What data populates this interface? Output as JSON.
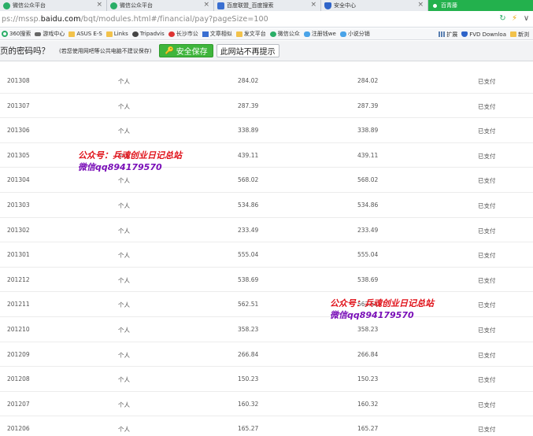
{
  "tabs": [
    {
      "label": "微信公众平台",
      "icon": "wechat-icon",
      "active": false
    },
    {
      "label": "微信公众平台",
      "icon": "wechat-icon",
      "active": false
    },
    {
      "label": "百度联盟_百度搜索",
      "icon": "baidu-paw-icon",
      "active": false
    },
    {
      "label": "安全中心",
      "icon": "shield-icon",
      "active": false
    },
    {
      "label": "百青藤",
      "icon": "baiqingteng-icon",
      "active": true
    }
  ],
  "tab_close": "×",
  "address": {
    "prefix": "ps://mssp.",
    "domain": "baidu.com",
    "path": "/bqt/modules.html#/financial/pay?pageSize=100"
  },
  "bookmarks": [
    {
      "label": "360搜索",
      "icon": "360-icon"
    },
    {
      "label": "游戏中心",
      "icon": "gamepad-icon"
    },
    {
      "label": "ASUS E-S",
      "icon": "folder-icon"
    },
    {
      "label": "Links",
      "icon": "folder-icon"
    },
    {
      "label": "Tripadvis",
      "icon": "owl-icon"
    },
    {
      "label": "长沙市公",
      "icon": "emblem-icon"
    },
    {
      "label": "文章相似",
      "icon": "document-icon"
    },
    {
      "label": "发文平台",
      "icon": "folder-icon"
    },
    {
      "label": "微信公众",
      "icon": "wechat-icon"
    },
    {
      "label": "注册钱we",
      "icon": "cloud-icon"
    },
    {
      "label": "小说分销",
      "icon": "cloud-icon"
    }
  ],
  "bookmarks_right": [
    {
      "label": "扩展",
      "icon": "grid-icon"
    },
    {
      "label": "FVD Downloa",
      "icon": "shield-icon"
    },
    {
      "label": "新浏",
      "icon": "folder-icon"
    }
  ],
  "password_bar": {
    "question": "页的密码吗？",
    "hint": "(若您使用网吧等公共电脑不建议保存)",
    "save_label": "安全保存",
    "never_label": "此网站不再提示"
  },
  "table": {
    "rows": [
      {
        "period": "201308",
        "type": "个人",
        "amount1": "284.02",
        "amount2": "284.02",
        "status": "已支付"
      },
      {
        "period": "201307",
        "type": "个人",
        "amount1": "287.39",
        "amount2": "287.39",
        "status": "已支付"
      },
      {
        "period": "201306",
        "type": "个人",
        "amount1": "338.89",
        "amount2": "338.89",
        "status": "已支付"
      },
      {
        "period": "201305",
        "type": "个人",
        "amount1": "439.11",
        "amount2": "439.11",
        "status": "已支付"
      },
      {
        "period": "201304",
        "type": "个人",
        "amount1": "568.02",
        "amount2": "568.02",
        "status": "已支付"
      },
      {
        "period": "201303",
        "type": "个人",
        "amount1": "534.86",
        "amount2": "534.86",
        "status": "已支付"
      },
      {
        "period": "201302",
        "type": "个人",
        "amount1": "233.49",
        "amount2": "233.49",
        "status": "已支付"
      },
      {
        "period": "201301",
        "type": "个人",
        "amount1": "555.04",
        "amount2": "555.04",
        "status": "已支付"
      },
      {
        "period": "201212",
        "type": "个人",
        "amount1": "538.69",
        "amount2": "538.69",
        "status": "已支付"
      },
      {
        "period": "201211",
        "type": "个人",
        "amount1": "562.51",
        "amount2": "562.51",
        "status": "已支付"
      },
      {
        "period": "201210",
        "type": "个人",
        "amount1": "358.23",
        "amount2": "358.23",
        "status": "已支付"
      },
      {
        "period": "201209",
        "type": "个人",
        "amount1": "266.84",
        "amount2": "266.84",
        "status": "已支付"
      },
      {
        "period": "201208",
        "type": "个人",
        "amount1": "150.23",
        "amount2": "150.23",
        "status": "已支付"
      },
      {
        "period": "201207",
        "type": "个人",
        "amount1": "160.32",
        "amount2": "160.32",
        "status": "已支付"
      },
      {
        "period": "201206",
        "type": "个人",
        "amount1": "165.27",
        "amount2": "165.27",
        "status": "已支付"
      }
    ]
  },
  "watermark": {
    "line1": "公众号：兵魂创业日记总站",
    "line2": "微信qq894179570"
  },
  "colors": {
    "active_tab": "#23b14d",
    "save_button": "#3fb53c",
    "watermark_line1": "#e0121a",
    "watermark_line2": "#7a10b8"
  }
}
